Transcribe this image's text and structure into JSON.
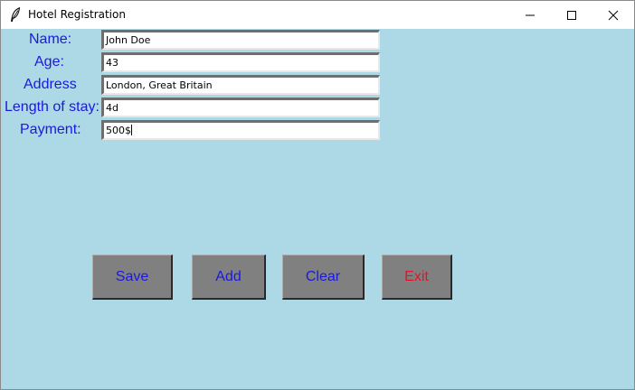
{
  "window": {
    "title": "Hotel Registration",
    "icon": "feather-icon",
    "controls": {
      "minimize": "minimize-icon",
      "maximize": "maximize-icon",
      "close": "close-icon"
    }
  },
  "form": {
    "fields": [
      {
        "label": "Name:",
        "value": "John Doe"
      },
      {
        "label": "Age:",
        "value": "43"
      },
      {
        "label": "Address",
        "value": "London, Great Britain"
      },
      {
        "label": "Length of stay:",
        "value": "4d"
      },
      {
        "label": "Payment:",
        "value": "500$"
      }
    ]
  },
  "buttons": {
    "save": "Save",
    "add": "Add",
    "clear": "Clear",
    "exit": "Exit"
  },
  "colors": {
    "background": "#add8e6",
    "label_text": "#1a1adb",
    "button_face": "#808080",
    "exit_text": "#e0142a"
  }
}
